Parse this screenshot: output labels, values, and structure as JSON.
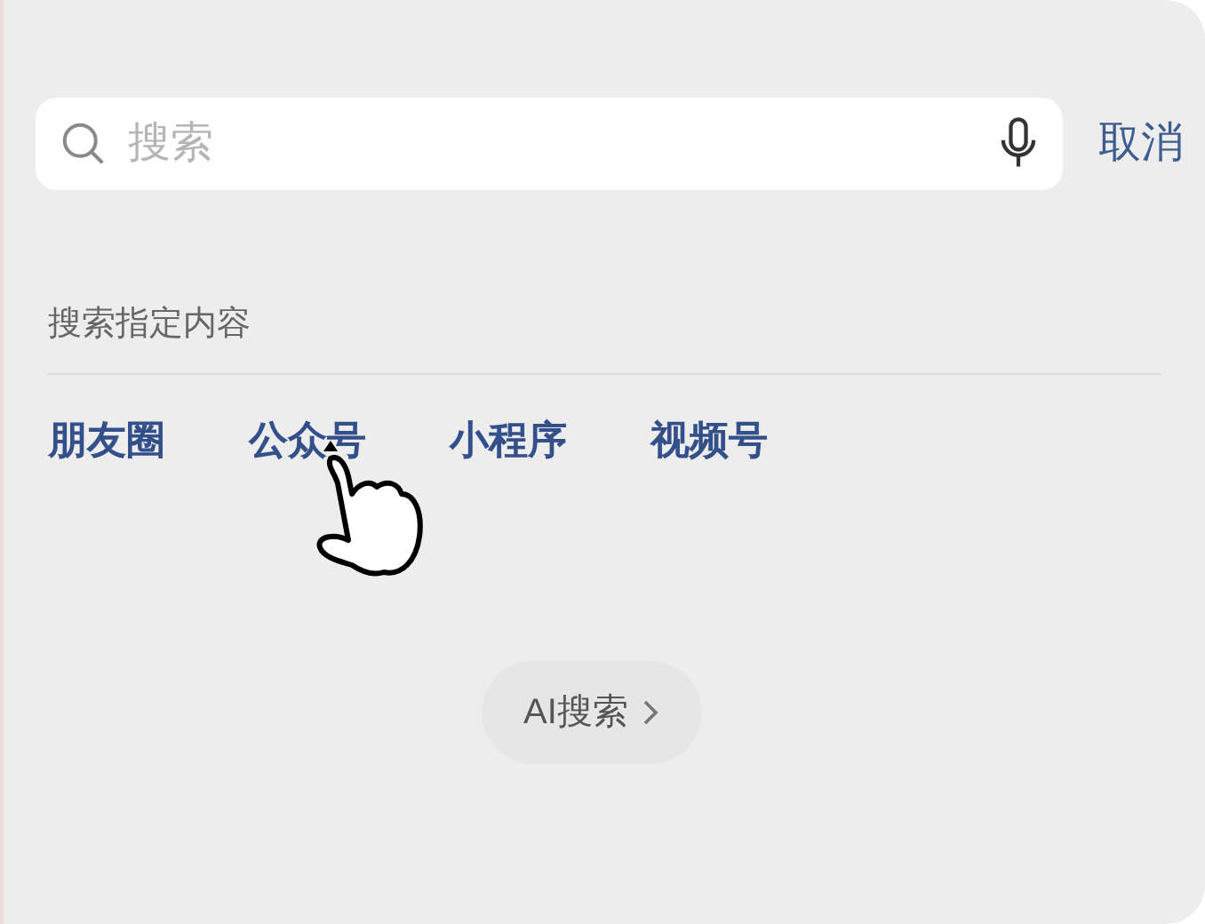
{
  "search": {
    "placeholder": "搜索"
  },
  "cancel": "取消",
  "section_title": "搜索指定内容",
  "categories": [
    "朋友圈",
    "公众号",
    "小程序",
    "视频号"
  ],
  "ai_button": "AI搜索"
}
